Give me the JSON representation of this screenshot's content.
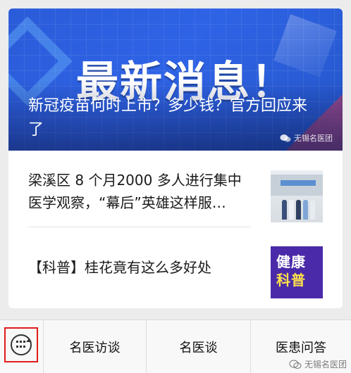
{
  "hero": {
    "overlay_text": "最新消息！",
    "title": "新冠疫苗何时上市？多少钱？官方回应来了",
    "source": "无锡名医团",
    "accent_color": "#2f63e6"
  },
  "articles": [
    {
      "title": "梁溪区 8 个月2000 多人进行集中医学观察，“幕后”英雄这样服…",
      "thumb_icon": "group-photo-thumbnail"
    },
    {
      "title": "【科普】桂花竟有这么多好处",
      "thumb_icon": "health-science-thumbnail",
      "thumb_line1": "健康",
      "thumb_line2": "科普"
    }
  ],
  "menu": {
    "keyboard_icon": "keyboard-toggle-icon",
    "highlight_color": "#e01c1c",
    "items": [
      "名医访谈",
      "名医谈",
      "医患问答"
    ]
  },
  "watermark": "无锡名医团"
}
